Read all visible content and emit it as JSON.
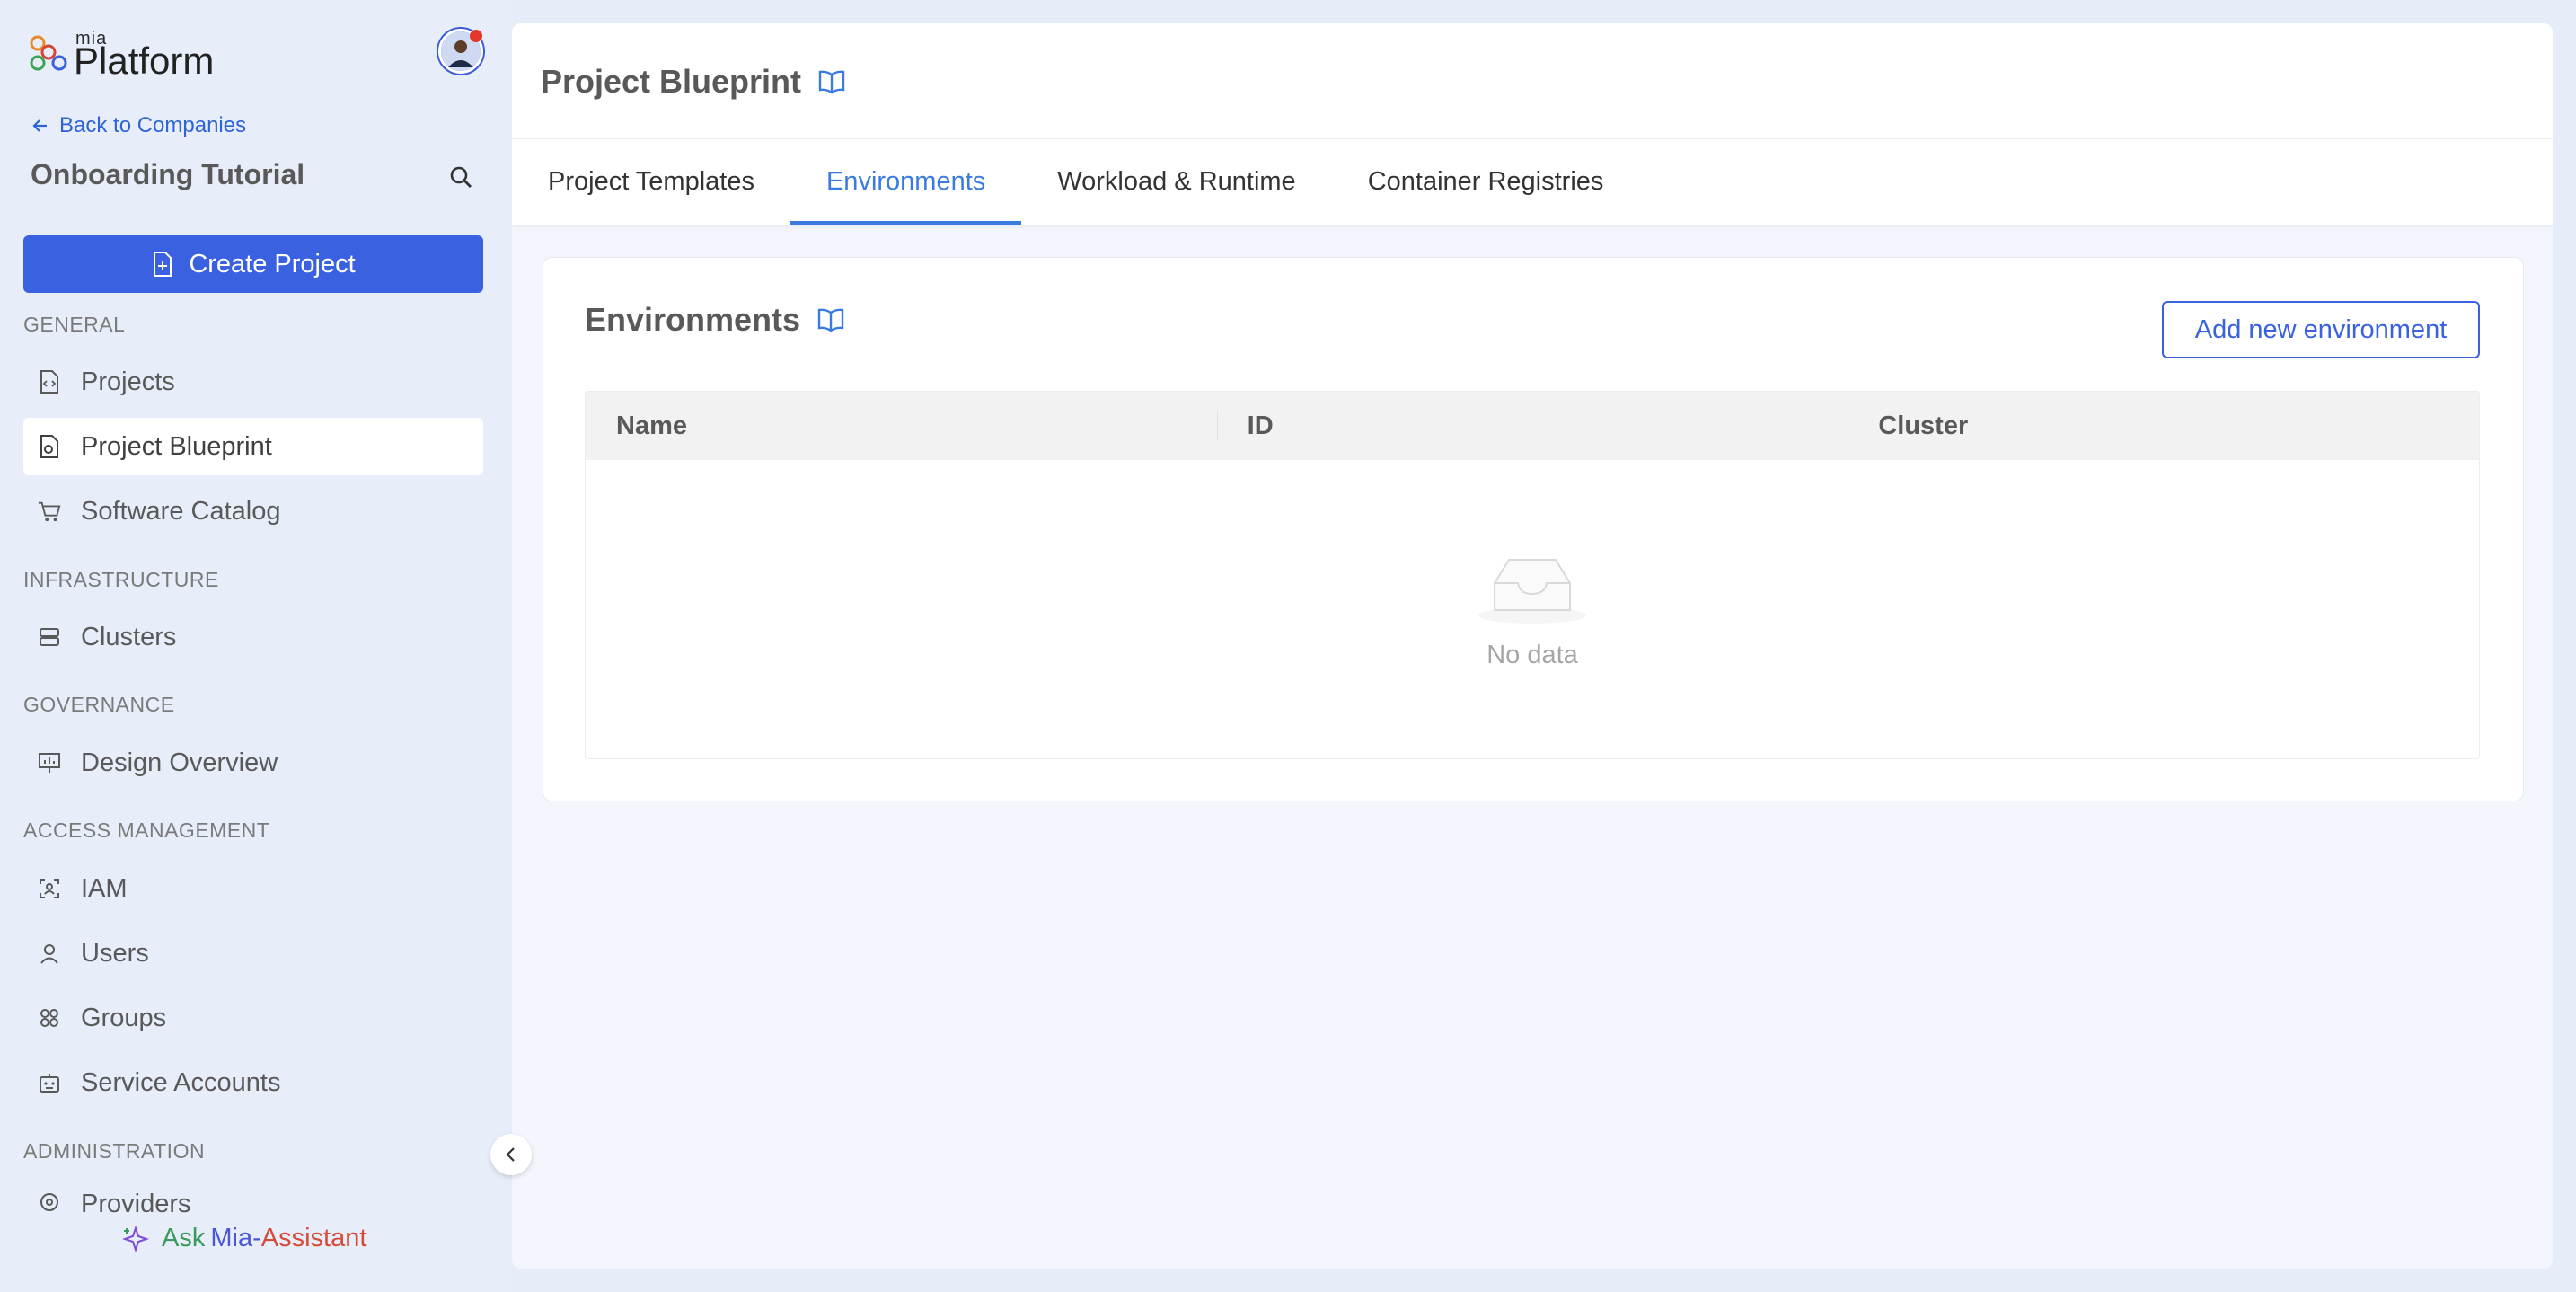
{
  "brand": {
    "small": "mia",
    "name": "Platform"
  },
  "sidebar": {
    "back_label": "Back to Companies",
    "company": "Onboarding Tutorial",
    "create_label": "Create Project",
    "sections": {
      "general": "GENERAL",
      "infrastructure": "INFRASTRUCTURE",
      "governance": "GOVERNANCE",
      "access": "ACCESS MANAGEMENT",
      "administration": "ADMINISTRATION"
    },
    "items": {
      "projects": "Projects",
      "blueprint": "Project Blueprint",
      "catalog": "Software Catalog",
      "clusters": "Clusters",
      "design": "Design Overview",
      "iam": "IAM",
      "users": "Users",
      "groups": "Groups",
      "service_accounts": "Service Accounts",
      "providers": "Providers"
    },
    "ask": {
      "prefix": "Ask",
      "mia": "Mia-",
      "assistant": "Assistant"
    }
  },
  "header": {
    "title": "Project Blueprint",
    "tabs": [
      "Project Templates",
      "Environments",
      "Workload & Runtime",
      "Container Registries"
    ],
    "active_tab": "Environments"
  },
  "card": {
    "title": "Environments",
    "add_label": "Add new environment",
    "columns": [
      "Name",
      "ID",
      "Cluster"
    ],
    "empty_text": "No data"
  },
  "colors": {
    "accent": "#3a62e0",
    "tab_active": "#3a7be0",
    "sidebar_bg": "#e7eef9"
  }
}
